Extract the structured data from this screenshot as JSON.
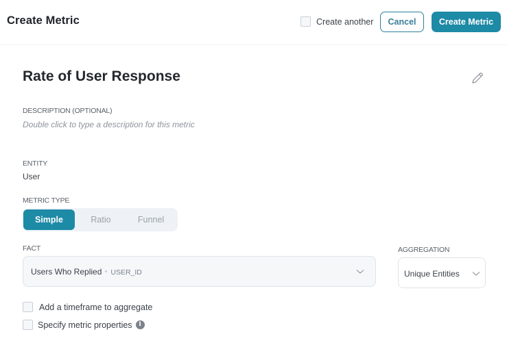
{
  "header": {
    "title": "Create Metric",
    "create_another_label": "Create another",
    "create_another_checked": false,
    "cancel_label": "Cancel",
    "create_label": "Create Metric"
  },
  "metric": {
    "name": "Rate of User Response",
    "edit_icon": "pencil-icon"
  },
  "description": {
    "label": "DESCRIPTION (OPTIONAL)",
    "placeholder": "Double click to type a description for this metric"
  },
  "entity": {
    "label": "ENTITY",
    "value": "User"
  },
  "metric_type": {
    "label": "METRIC TYPE",
    "options": [
      "Simple",
      "Ratio",
      "Funnel"
    ],
    "selected": "Simple"
  },
  "fact": {
    "label": "FACT",
    "value": "Users Who Replied",
    "sub_value": "USER_ID"
  },
  "aggregation": {
    "label": "AGGREGATION",
    "value": "Unique Entities"
  },
  "options": {
    "timeframe_label": "Add a timeframe to aggregate",
    "timeframe_checked": false,
    "properties_label": "Specify metric properties",
    "properties_checked": false,
    "info_icon": "info-icon"
  },
  "colors": {
    "accent": "#1d8aa6",
    "cancel_border": "#2d7f9b"
  }
}
